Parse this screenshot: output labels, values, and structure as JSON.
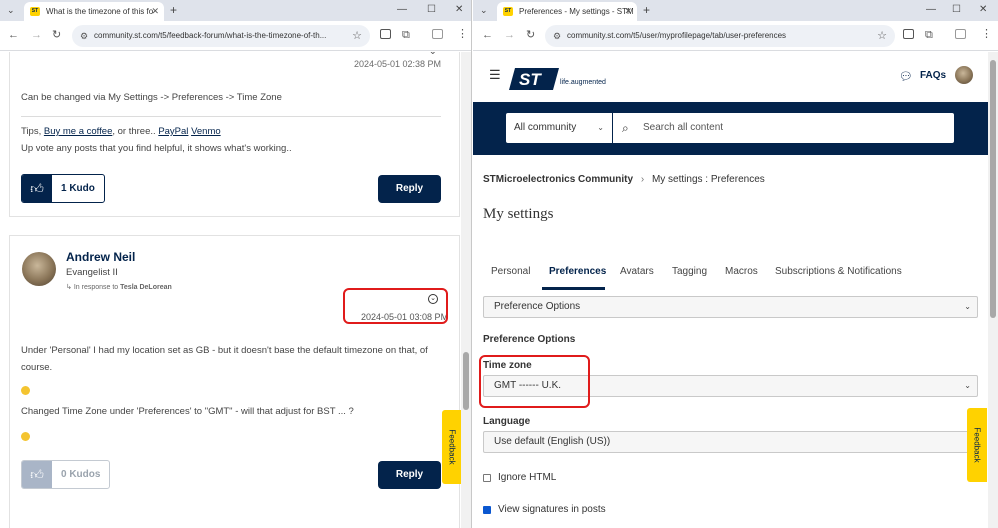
{
  "left": {
    "tab_title": "What is the timezone of this fo",
    "url": "community.st.com/t5/feedback-forum/what-is-the-timezone-of-th...",
    "post1": {
      "timestamp": "2024-05-01 02:38 PM",
      "text": "Can be changed via My Settings -> Preferences -> Time Zone",
      "sig_tips": "Tips,",
      "sig_coffee": "Buy me a coffee",
      "sig_or": ", or three..",
      "sig_paypal": "PayPal",
      "sig_venmo": "Venmo",
      "sig_line2": "Up vote any posts that you find helpful, it shows what's working..",
      "kudo_label": "1 Kudo",
      "reply_label": "Reply"
    },
    "post2": {
      "author": "Andrew Neil",
      "rank": "Evangelist II",
      "in_response_prefix": "In response to",
      "in_response_name": "Tesla DeLorean",
      "timestamp": "2024-05-01 03:08 PM",
      "para1_line1": "Under 'Personal' I had my location set as GB - but it doesn't base the default timezone on that, of",
      "para1_line2": "course.",
      "para2": "Changed Time Zone under 'Preferences'  to \"GMT\" - will that adjust for BST ... ?",
      "kudo_label": "0 Kudos",
      "reply_label": "Reply"
    },
    "feedback_label": "Feedback"
  },
  "right": {
    "tab_title": "Preferences - My settings - STM",
    "url": "community.st.com/t5/user/myprofilepage/tab/user-preferences",
    "logo_tagline": "life.augmented",
    "faqs_label": "FAQs",
    "scope_select": "All community",
    "search_placeholder": "Search all content",
    "breadcrumb_home": "STMicroelectronics Community",
    "breadcrumb_sep": "›",
    "breadcrumb_current": "My settings : Preferences",
    "page_title": "My settings",
    "tabs": [
      "Personal",
      "Preferences",
      "Avatars",
      "Tagging",
      "Macros",
      "Subscriptions & Notifications"
    ],
    "section_select": "Preference Options",
    "section_heading": "Preference Options",
    "timezone_label": "Time zone",
    "timezone_value": "GMT ------ U.K.",
    "language_label": "Language",
    "language_value": "Use default (English (US))",
    "ignore_html_label": "Ignore HTML",
    "view_sigs_label": "View signatures in posts",
    "feedback_label": "Feedback"
  },
  "colors": {
    "st_navy": "#03234b",
    "st_yellow": "#ffd200",
    "highlight_red": "#e01b1b"
  }
}
